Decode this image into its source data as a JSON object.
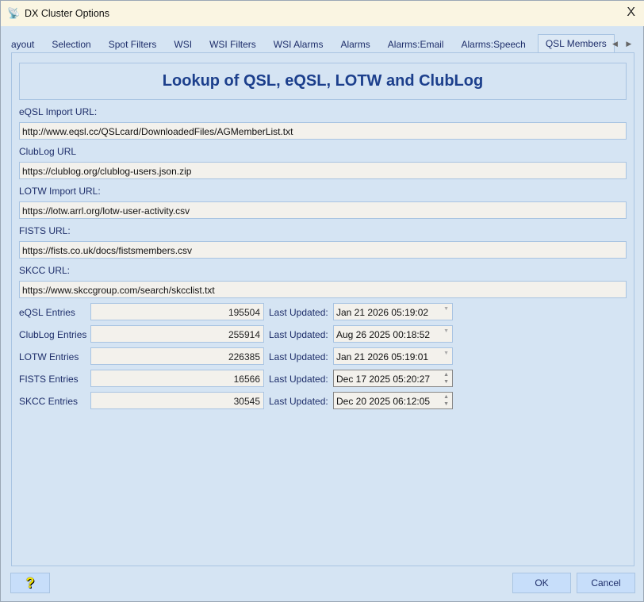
{
  "window": {
    "title": "DX Cluster Options",
    "close": "X"
  },
  "tabs": [
    "ayout",
    "Selection",
    "Spot Filters",
    "WSI",
    "WSI Filters",
    "WSI Alarms",
    "Alarms",
    "Alarms:Email",
    "Alarms:Speech",
    "QSL Members"
  ],
  "tab_arrows": "◀ ▶",
  "header": "Lookup of QSL, eQSL, LOTW and ClubLog",
  "urls": [
    {
      "label": "eQSL Import URL:",
      "value": "http://www.eqsl.cc/QSLcard/DownloadedFiles/AGMemberList.txt"
    },
    {
      "label": "ClubLog URL",
      "value": "https://clublog.org/clublog-users.json.zip"
    },
    {
      "label": "LOTW Import URL:",
      "value": "https://lotw.arrl.org/lotw-user-activity.csv"
    },
    {
      "label": "FISTS URL:",
      "value": "https://fists.co.uk/docs/fistsmembers.csv"
    },
    {
      "label": "SKCC URL:",
      "value": "https://www.skccgroup.com/search/skcclist.txt"
    }
  ],
  "last_updated_label": "Last Updated:",
  "entries": [
    {
      "label": "eQSL Entries",
      "count": "195504",
      "date": "Jan 21 2026 05:19:02"
    },
    {
      "label": "ClubLog Entries",
      "count": "255914",
      "date": "Aug 26 2025 00:18:52"
    },
    {
      "label": "LOTW Entries",
      "count": "226385",
      "date": "Jan 21 2026 05:19:01"
    },
    {
      "label": "FISTS Entries",
      "count": "16566",
      "date": "Dec 17 2025 05:20:27"
    },
    {
      "label": "SKCC Entries",
      "count": "30545",
      "date": "Dec 20 2025 06:12:05"
    }
  ],
  "buttons": {
    "help": "?",
    "ok": "OK",
    "cancel": "Cancel"
  }
}
